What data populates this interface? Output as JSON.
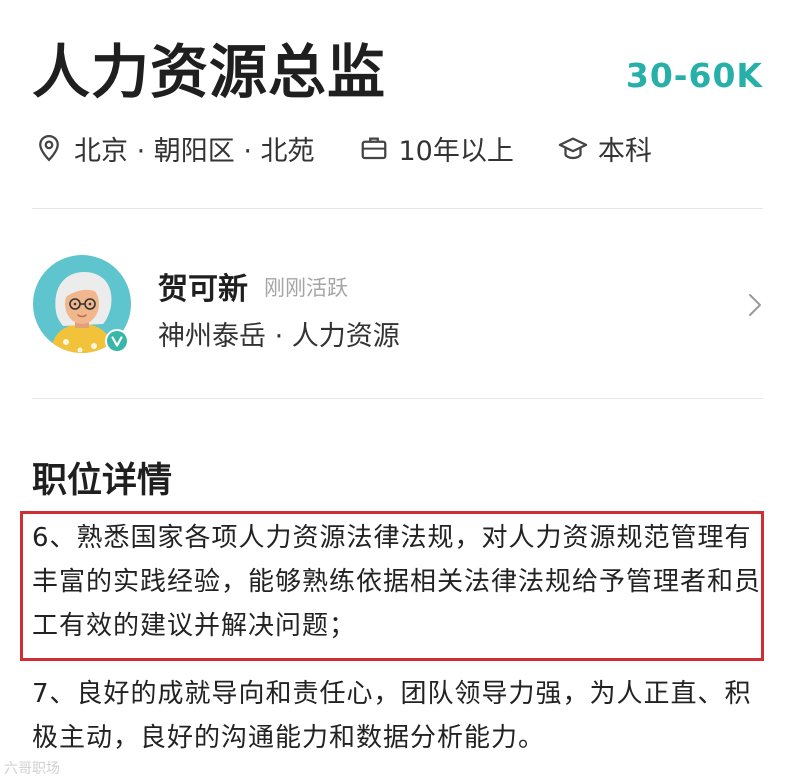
{
  "job": {
    "title": "人力资源总监",
    "salary": "30-60K",
    "location": "北京 · 朝阳区 · 北苑",
    "experience": "10年以上",
    "education": "本科"
  },
  "recruiter": {
    "name": "贺可新",
    "status": "刚刚活跃",
    "company_role": "神州泰岳 · 人力资源"
  },
  "details": {
    "heading": "职位详情",
    "items": [
      "6、熟悉国家各项人力资源法律法规，对人力资源规范管理有丰富的实践经验，能够熟练依据相关法律法规给予管理者和员工有效的建议并解决问题；",
      "7、良好的成就导向和责任心，团队领导力强，为人正直、积极主动，良好的沟通能力和数据分析能力。"
    ]
  },
  "watermark": "六哥职场",
  "colors": {
    "salary": "#27b0a9",
    "highlight_border": "#cf2f34",
    "avatar_bg": "#5ec4ce",
    "verified": "#38b6a8"
  },
  "icons": {
    "location": "location-pin-icon",
    "experience": "briefcase-icon",
    "education": "graduation-cap-icon",
    "chevron": "chevron-right-icon",
    "verified": "verified-badge-icon"
  }
}
